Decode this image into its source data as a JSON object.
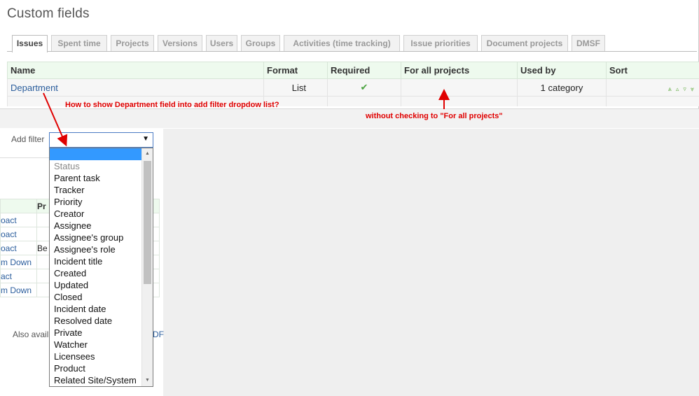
{
  "page": {
    "title": "Custom fields"
  },
  "tabs": [
    {
      "label": "Issues"
    },
    {
      "label": "Spent time"
    },
    {
      "label": "Projects"
    },
    {
      "label": "Versions"
    },
    {
      "label": "Users"
    },
    {
      "label": "Groups"
    },
    {
      "label": "Activities (time tracking)"
    },
    {
      "label": "Issue priorities"
    },
    {
      "label": "Document projects"
    },
    {
      "label": "DMSF"
    }
  ],
  "table": {
    "headers": {
      "name": "Name",
      "format": "Format",
      "required": "Required",
      "for_all_projects": "For all projects",
      "used_by": "Used by",
      "sort": "Sort"
    },
    "row": {
      "name": "Department",
      "format": "List",
      "required_mark": "✔",
      "used_by": "1 category"
    }
  },
  "annotations": {
    "question": "How to show Department field into add filter dropdow list?",
    "note": "without checking to \"For all projects\""
  },
  "filter": {
    "label": "Add filter",
    "options": [
      "Status",
      "Parent task",
      "Tracker",
      "Priority",
      "Creator",
      "Assignee",
      "Assignee's group",
      "Assignee's role",
      "Incident title",
      "Created",
      "Updated",
      "Closed",
      "Incident date",
      "Resolved date",
      "Private",
      "Watcher",
      "Licensees",
      "Product",
      "Related Site/System"
    ]
  },
  "background": {
    "col_header": "Pr",
    "rows": [
      {
        "a": "oact",
        "b": ""
      },
      {
        "a": "oact",
        "b": ""
      },
      {
        "a": "oact",
        "b": "Be"
      },
      {
        "a": "m Down",
        "b": ""
      },
      {
        "a": "act",
        "b": ""
      },
      {
        "a": "m Down",
        "b": ""
      }
    ],
    "also": "Also avail",
    "also_right": "DF"
  }
}
